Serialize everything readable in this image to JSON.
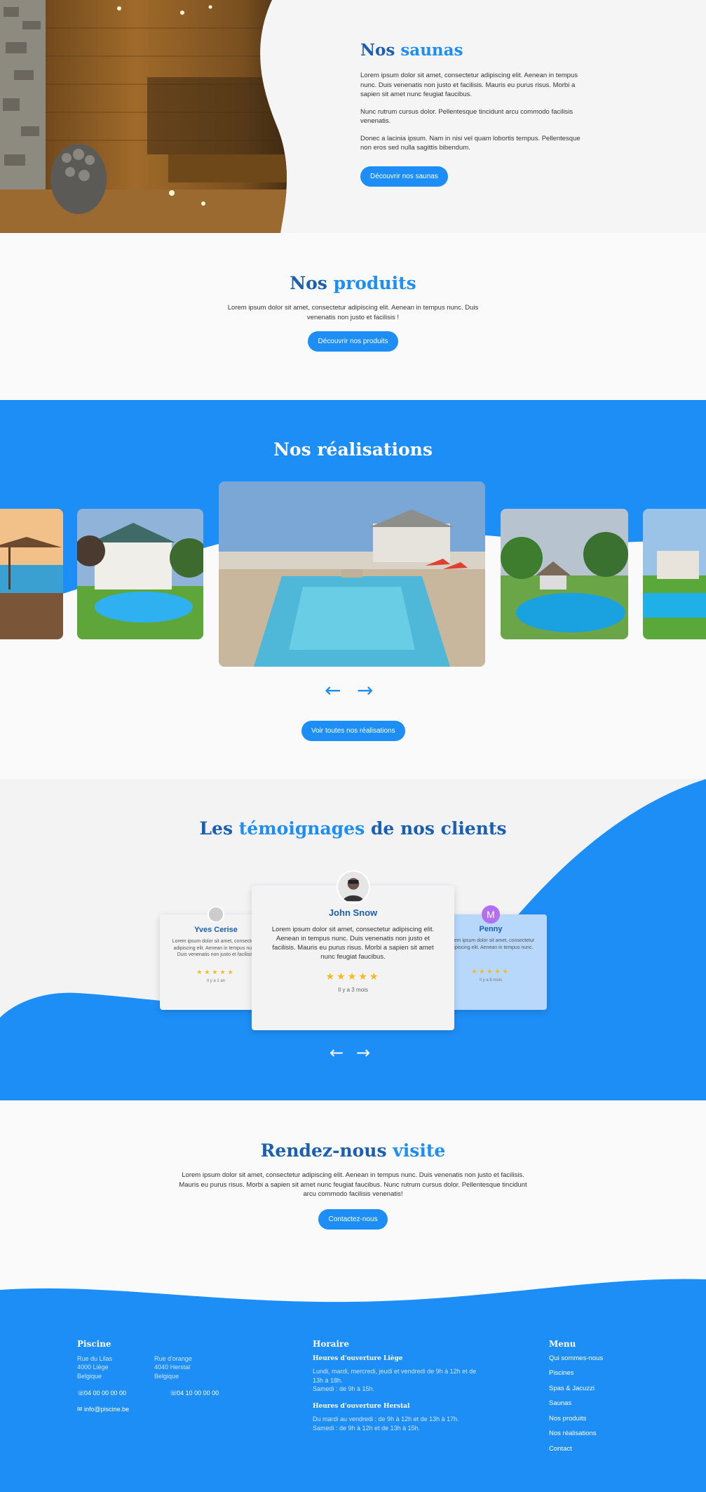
{
  "saunas": {
    "title_a": "Nos",
    "title_b": "saunas",
    "p1": "Lorem ipsum dolor sit amet, consectetur adipiscing elit. Aenean in tempus nunc. Duis venenatis non justo et facilisis. Mauris eu purus risus. Morbi a sapien sit amet nunc feugiat faucibus.",
    "p2": "Nunc rutrum cursus dolor. Pellentesque tincidunt arcu commodo facilisis venenatis.",
    "p3": "Donec a lacinia ipsum. Nam in nisi vel quam lobortis tempus. Pellentesque non eros sed nulla sagittis bibendum.",
    "button": "Découvrir nos saunas"
  },
  "produits": {
    "title_a": "Nos",
    "title_b": "produits",
    "text": "Lorem ipsum dolor sit amet, consectetur adipiscing elit. Aenean in tempus nunc. Duis venenatis non justo et facilisis !",
    "button": "Découvrir nos produits"
  },
  "realisations": {
    "title": "Nos réalisations",
    "prev": "←",
    "next": "→",
    "button": "Voir toutes nos réalisations"
  },
  "temoignages": {
    "title_a": "Les",
    "title_b": "témoignages",
    "title_c": "de nos clients",
    "cards": [
      {
        "name": "Yves Cerise",
        "text": "Lorem ipsum dolor sit amet, consectetur adipiscing elit. Aenean in tempus nunc. Duis venenatis non justo et facilisis.",
        "stars": "★★★★★",
        "time": "Il y a 1 an"
      },
      {
        "name": "John Snow",
        "text": "Lorem ipsum dolor sit amet, consectetur adipiscing elit. Aenean in tempus nunc. Duis venenatis non justo et facilisis. Mauris eu purus risus. Morbi a sapien sit amet nunc feugiat faucibus.",
        "stars": "★★★★★",
        "time": "Il y a 3 mois"
      },
      {
        "name": "Penny",
        "initial": "M",
        "text": "Lorem ipsum dolor sit amet, consectetur adipiscing elit. Aenean in tempus nunc.",
        "stars": "★★★★★",
        "time": "Il y a 6 mois"
      }
    ],
    "prev": "←",
    "next": "→"
  },
  "visite": {
    "title_a": "Rendez-nous",
    "title_b": "visite",
    "text": "Lorem ipsum dolor sit amet, consectetur adipiscing elit. Aenean in tempus nunc. Duis venenatis non justo et facilisis. Mauris eu purus risus. Morbi a sapien sit amet nunc feugiat faucibus. Nunc rutrum cursus dolor. Pellentesque tincidunt arcu commodo facilisis venenatis!",
    "button": "Contactez-nous"
  },
  "footer": {
    "piscine": {
      "title": "Piscine",
      "addr1": [
        "Rue du Lilas",
        "4000 Liège",
        "Belgique"
      ],
      "addr2": [
        "Rue d'orange",
        "4040 Herstal",
        "Belgique"
      ],
      "phone1": "04 00 00 00 00",
      "phone2": "04 10 00 00 00",
      "email": "info@piscine.be"
    },
    "horaire": {
      "title": "Horaire",
      "liege_title": "Heures d'ouverture Liège",
      "liege_text": "Lundi, mardi, mercredi, jeudi et vendredi de 9h à 12h et de 13h à 18h.",
      "liege_sat": "Samedi : de 9h à 15h.",
      "herstal_title": "Heures d'ouverture Herstal",
      "herstal_text": "Du mardi au vendredi : de 9h à 12h et de 13h à 17h.",
      "herstal_sat": "Samedi : de 9h à 12h et de 13h à 15h."
    },
    "menu": {
      "title": "Menu",
      "items": [
        "Qui sommes-nous",
        "Piscines",
        "Spas & Jacuzzi",
        "Saunas",
        "Nos produits",
        "Nos réalisations",
        "Contact"
      ]
    }
  },
  "colors": {
    "primary": "#1e8ef7",
    "dark_blue": "#1b5fb2",
    "star": "#f5b918"
  }
}
